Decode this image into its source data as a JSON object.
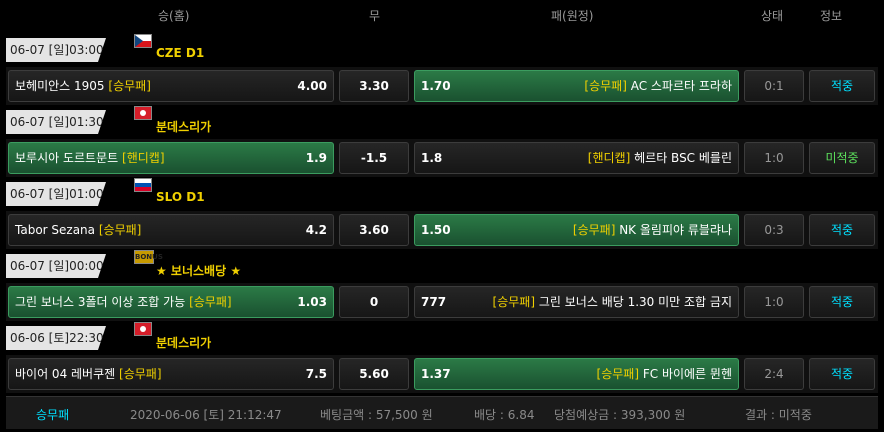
{
  "header": {
    "home": "승(홈)",
    "draw": "무",
    "away": "패(원정)",
    "status": "상태",
    "info": "정보"
  },
  "matches": [
    {
      "datetime": "06-07 [일]03:00",
      "flag": "czech-flag-icon",
      "league": "CZE D1",
      "home": {
        "team": "보헤미안스 1905",
        "market": "[승무패]",
        "odd": "4.00"
      },
      "draw": "3.30",
      "away": {
        "odd": "1.70",
        "market": "[승무패]",
        "team": "AC 스파르타 프라하"
      },
      "score": "0:1",
      "result": "적중"
    },
    {
      "datetime": "06-07 [일]01:30",
      "flag": "germany-flag-icon",
      "league": "분데스리가",
      "home": {
        "team": "보루시아 도르트문트",
        "market": "[핸디캡]",
        "odd": "1.9"
      },
      "draw": "-1.5",
      "away": {
        "odd": "1.8",
        "market": "[핸디캡]",
        "team": "헤르타 BSC 베를린"
      },
      "score": "1:0",
      "result": "미적중"
    },
    {
      "datetime": "06-07 [일]01:00",
      "flag": "slovenia-flag-icon",
      "league": "SLO D1",
      "home": {
        "team": "Tabor Sezana",
        "market": "[승무패]",
        "odd": "4.2"
      },
      "draw": "3.60",
      "away": {
        "odd": "1.50",
        "market": "[승무패]",
        "team": "NK 올림피야 류블랴나"
      },
      "score": "0:3",
      "result": "적중"
    },
    {
      "datetime": "06-07 [일]00:00",
      "flag": "bonus-icon",
      "league": "★ 보너스배당 ★",
      "home": {
        "team": "그린 보너스 3폴더 이상 조합 가능",
        "market": "[승무패]",
        "odd": "1.03"
      },
      "draw": "0",
      "away": {
        "odd": "777",
        "market": "[승무패]",
        "team": "그린 보너스 배당 1.30 미만 조합 금지"
      },
      "score": "1:0",
      "result": "적중"
    },
    {
      "datetime": "06-06 [토]22:30",
      "flag": "germany-flag-icon",
      "league": "분데스리가",
      "home": {
        "team": "바이어 04 레버쿠젠",
        "market": "[승무패]",
        "odd": "7.5"
      },
      "draw": "5.60",
      "away": {
        "odd": "1.37",
        "market": "[승무패]",
        "team": "FC 바이에른 뮌헨"
      },
      "score": "2:4",
      "result": "적중"
    }
  ],
  "footer": {
    "type": "승무패",
    "time": "2020-06-06 [토] 21:12:47",
    "bet": "베팅금액 : 57,500 원",
    "odds": "배당 : 6.84",
    "expected": "당첨예상금 : 393,300 원",
    "result": "결과 : 미적중"
  },
  "colors": {
    "selected": "#2b7a46",
    "accent": "#00e0ff",
    "league": "#f0d000",
    "miss": "#5ce05c"
  },
  "brand_badge": "BONUS"
}
